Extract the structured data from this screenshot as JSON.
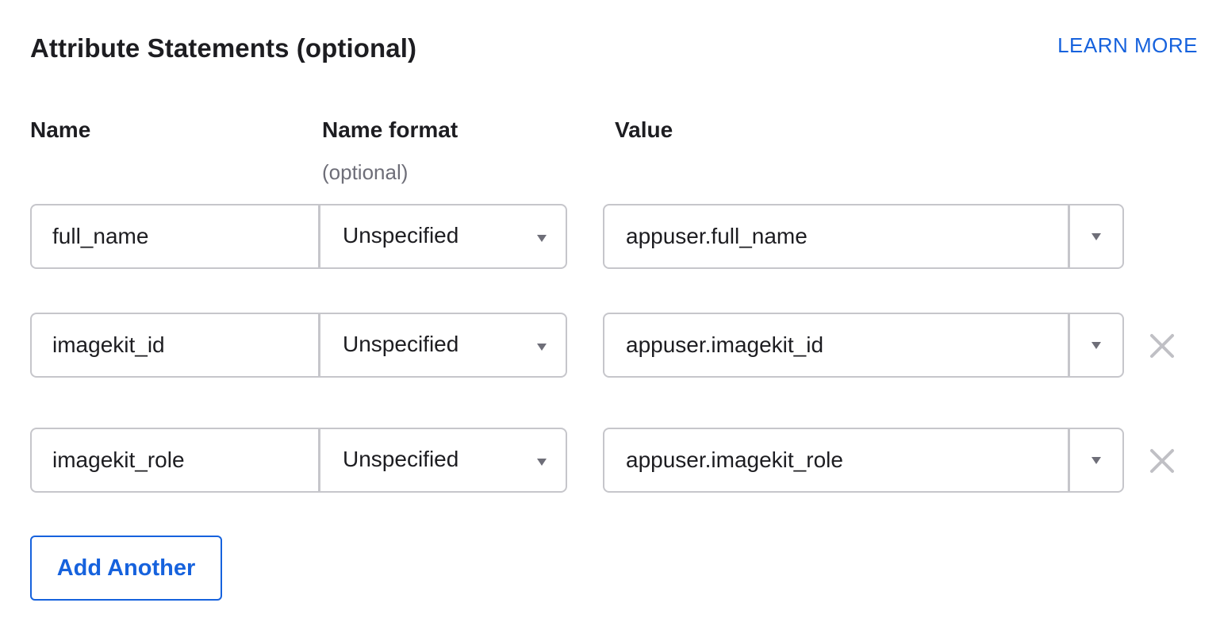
{
  "section": {
    "title": "Attribute Statements (optional)",
    "learn_more_label": "LEARN MORE"
  },
  "columns": {
    "name": "Name",
    "name_format": "Name format",
    "name_format_hint": "(optional)",
    "value": "Value"
  },
  "rows": [
    {
      "name": "full_name",
      "format": "Unspecified",
      "value": "appuser.full_name",
      "removable": false
    },
    {
      "name": "imagekit_id",
      "format": "Unspecified",
      "value": "appuser.imagekit_id",
      "removable": true
    },
    {
      "name": "imagekit_role",
      "format": "Unspecified",
      "value": "appuser.imagekit_role",
      "removable": true
    }
  ],
  "add_button_label": "Add Another",
  "icons": {
    "format_dropdown": "chevron-down-icon",
    "value_dropdown": "chevron-down-icon",
    "remove": "close-icon"
  },
  "colors": {
    "accent": "#1662dd",
    "border": "#c6c6cb",
    "text": "#1d1d21",
    "muted": "#6e6e78",
    "remove_icon": "#c0c0c5"
  }
}
